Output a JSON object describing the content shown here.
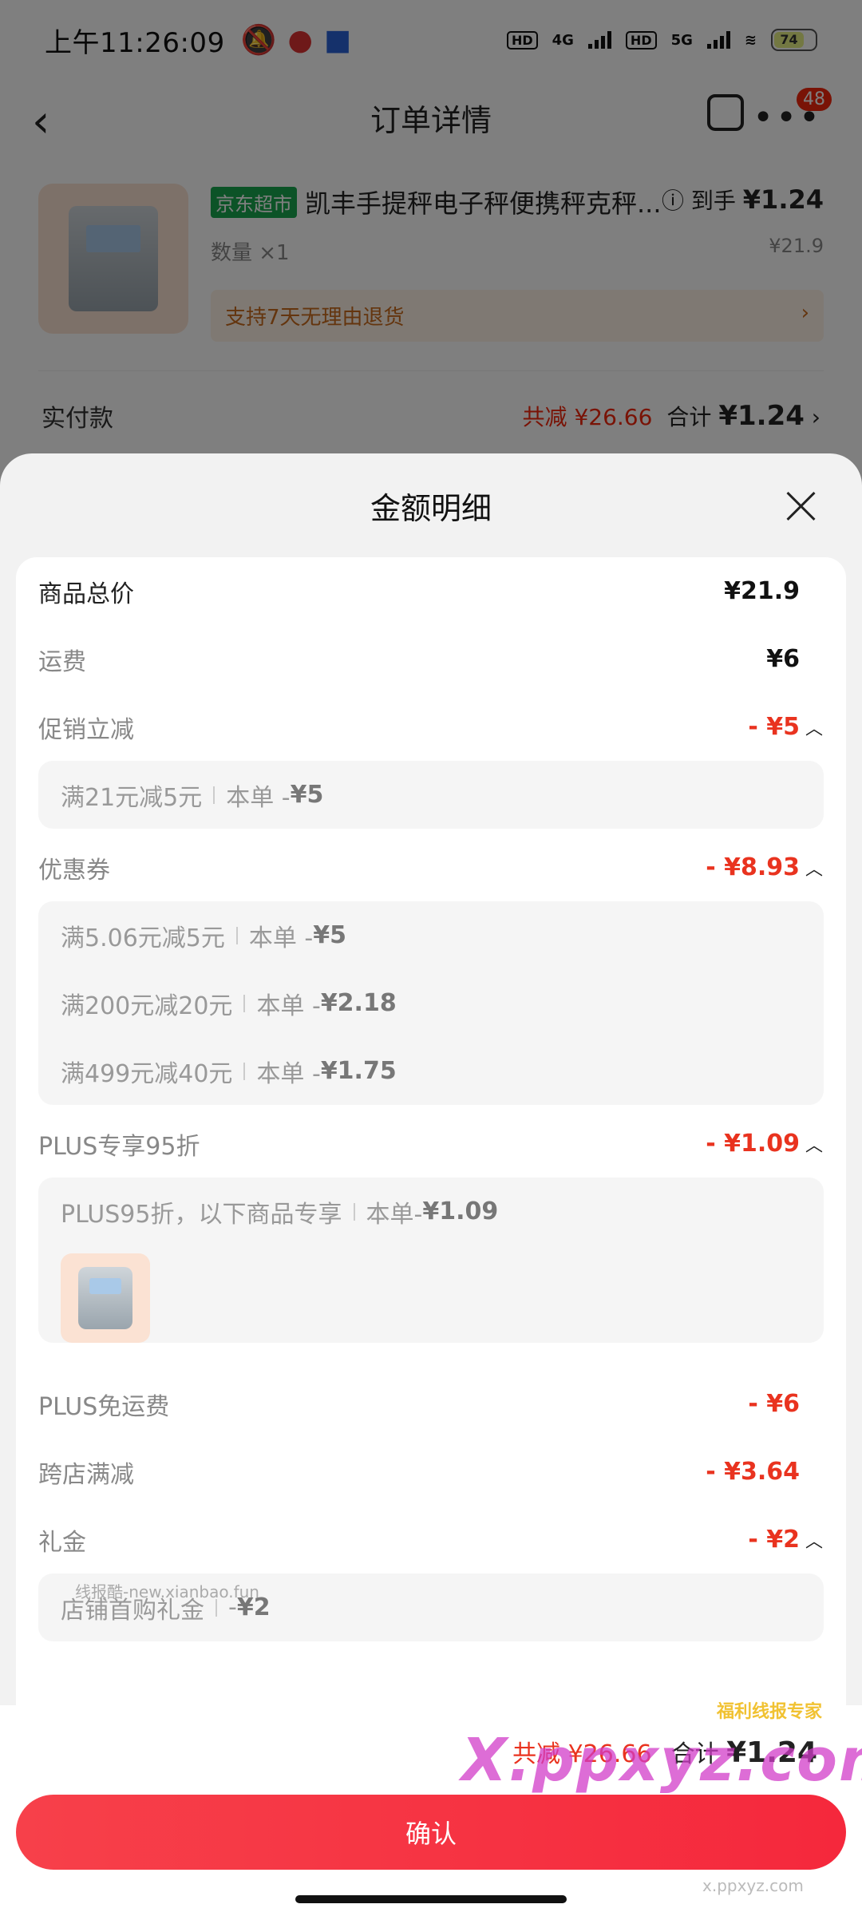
{
  "status_bar": {
    "time": "上午11:26:09",
    "net1": "4G",
    "net2": "5G",
    "battery": "74",
    "hd": "HD"
  },
  "nav": {
    "title": "订单详情",
    "badge": "48"
  },
  "product": {
    "tag": "京东超市",
    "name": "凯丰手提秤电子秤便携秤克秤...",
    "price_prefix": "到手",
    "price": "¥1.24",
    "quantity": "数量 ×1",
    "original_price": "¥21.9",
    "return_policy": "支持7天无理由退货"
  },
  "paid": {
    "label": "实付款",
    "reduce": "共减 ¥26.66",
    "total_prefix": "合计",
    "total": "¥1.24"
  },
  "sheet": {
    "title": "金额明细",
    "rows": {
      "goods_total": {
        "label": "商品总价",
        "value": "¥21.9"
      },
      "shipping": {
        "label": "运费",
        "value": "¥6"
      },
      "promo": {
        "label": "促销立减",
        "value": "- ¥5"
      },
      "coupon": {
        "label": "优惠券",
        "value": "- ¥8.93"
      },
      "plus": {
        "label": "PLUS专享95折",
        "value": "- ¥1.09"
      },
      "plus_ship": {
        "label": "PLUS免运费",
        "value": "- ¥6"
      },
      "cross_store": {
        "label": "跨店满减",
        "value": "- ¥3.64"
      },
      "gift": {
        "label": "礼金",
        "value": "- ¥2"
      }
    },
    "promo_details": [
      {
        "cond": "满21元减5元",
        "scope": "本单 -",
        "amt": "¥5"
      }
    ],
    "coupon_details": [
      {
        "cond": "满5.06元减5元",
        "scope": "本单 -",
        "amt": "¥5"
      },
      {
        "cond": "满200元减20元",
        "scope": "本单 -",
        "amt": "¥2.18"
      },
      {
        "cond": "满499元减40元",
        "scope": "本单 -",
        "amt": "¥1.75"
      }
    ],
    "plus_detail": {
      "cond": "PLUS95折，以下商品专享",
      "scope": "本单-",
      "amt": "¥1.09"
    },
    "gift_detail": {
      "cond": "店铺首购礼金",
      "scope": "-",
      "amt": "¥2"
    }
  },
  "footer": {
    "reduce": "共减 ¥26.66",
    "total_prefix": "合计",
    "total": "¥1.24",
    "confirm": "确认"
  },
  "watermarks": {
    "text": "线报酷-new.xianbao.fun",
    "logo": "X.ppxyz.com",
    "small": "x.ppxyz.com",
    "badge": "福利线报专家"
  }
}
